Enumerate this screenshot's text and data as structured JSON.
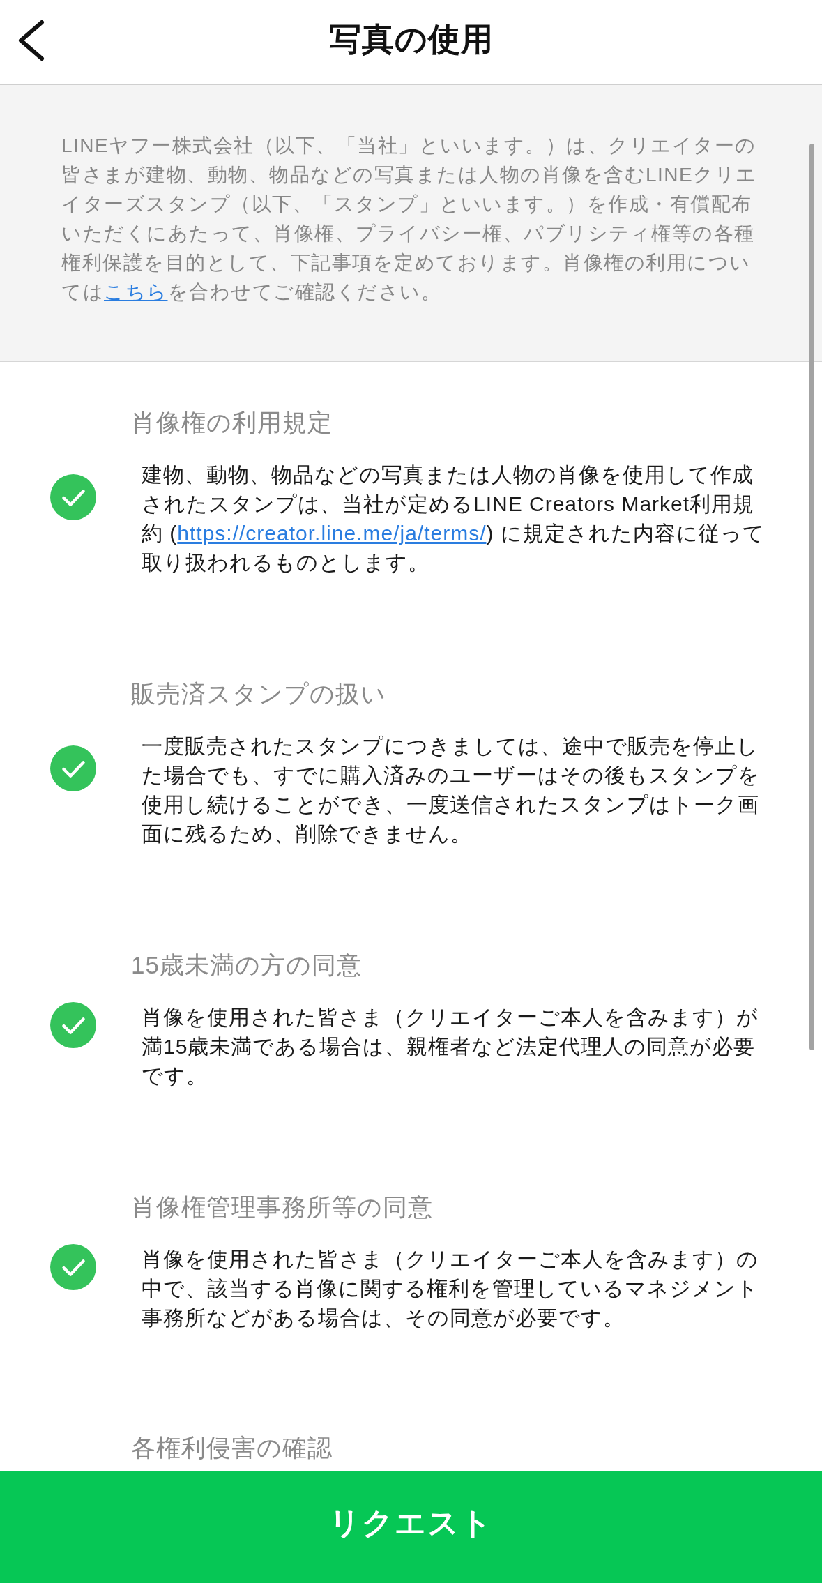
{
  "header": {
    "title": "写真の使用"
  },
  "intro": {
    "segments": [
      {
        "kind": "text",
        "text": "LINEヤフー株式会社（以下、「当社」といいます。）は、クリエイターの皆さまが建物、動物、物品などの写真または人物の肖像を含むLINEクリエイターズスタンプ（以下、「スタンプ」といいます。）を作成・有償配布いただくにあたって、肖像権、プライバシー権、パブリシティ権等の各種権利保護を目的として、下記事項を定めております。肖像権の利用については"
      },
      {
        "kind": "link",
        "text": "こちら"
      },
      {
        "kind": "text",
        "text": "を合わせてご確認ください。"
      }
    ]
  },
  "sections": [
    {
      "title": "肖像権の利用規定",
      "checked": true,
      "body": [
        {
          "kind": "text",
          "text": "建物、動物、物品などの写真または人物の肖像を使用して作成されたスタンプは、当社が定めるLINE Creators Market利用規約 ("
        },
        {
          "kind": "link",
          "text": "https://creator.line.me/ja/terms/"
        },
        {
          "kind": "text",
          "text": ") に規定された内容に従って取り扱われるものとします。"
        }
      ]
    },
    {
      "title": "販売済スタンプの扱い",
      "checked": true,
      "body": [
        {
          "kind": "text",
          "text": "一度販売されたスタンプにつきましては、途中で販売を停止した場合でも、すでに購入済みのユーザーはその後もスタンプを使用し続けることができ、一度送信されたスタンプはトーク画面に残るため、削除できません。"
        }
      ]
    },
    {
      "title": "15歳未満の方の同意",
      "checked": true,
      "body": [
        {
          "kind": "text",
          "text": "肖像を使用された皆さま（クリエイターご本人を含みます）が満15歳未満である場合は、親権者など法定代理人の同意が必要です。"
        }
      ]
    },
    {
      "title": "肖像権管理事務所等の同意",
      "checked": true,
      "body": [
        {
          "kind": "text",
          "text": "肖像を使用された皆さま（クリエイターご本人を含みます）の中で、該当する肖像に関する権利を管理しているマネジメント事務所などがある場合は、その同意が必要です。"
        }
      ]
    }
  ],
  "partial_section": {
    "title": "各権利侵害の確認"
  },
  "request_button": {
    "label": "リクエスト"
  }
}
